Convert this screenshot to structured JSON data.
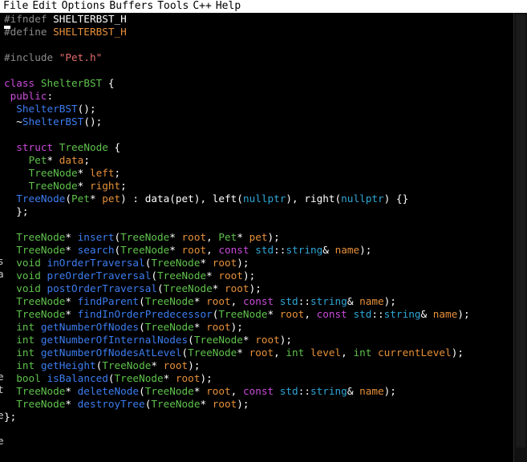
{
  "menu": [
    "File",
    "Edit",
    "Options",
    "Buffers",
    "Tools",
    "C++",
    "Help"
  ],
  "colors": {
    "background": "#000000",
    "preprocessor": "#8a8a8a",
    "macro": "#e6903a",
    "string": "#e46c6c",
    "keyword": "#c94bd9",
    "type": "#5fc24c",
    "function": "#3c7df0",
    "builtin": "#2fa6d6",
    "plain": "#ffffff"
  },
  "lines": [
    [
      [
        "#ifndef ",
        "pp"
      ],
      [
        "SHELTERBST_H",
        "macro-w"
      ]
    ],
    [
      [
        "#define ",
        "pp"
      ],
      [
        "SHELTERBST_H",
        "macro"
      ]
    ],
    [],
    [
      [
        "#include ",
        "pp"
      ],
      [
        "\"Pet.h\"",
        "str"
      ]
    ],
    [],
    [
      [
        "class ",
        "kw"
      ],
      [
        "ShelterBST",
        "type"
      ],
      [
        " {",
        "plain"
      ]
    ],
    [
      [
        " public",
        "kw"
      ],
      [
        ":",
        "plain"
      ]
    ],
    [
      [
        "  ",
        "plain"
      ],
      [
        "ShelterBST",
        "fn"
      ],
      [
        "();",
        "plain"
      ]
    ],
    [
      [
        "  ~",
        "plain"
      ],
      [
        "ShelterBST",
        "fn"
      ],
      [
        "();",
        "plain"
      ]
    ],
    [],
    [
      [
        "  ",
        "plain"
      ],
      [
        "struct ",
        "kw"
      ],
      [
        "TreeNode",
        "type"
      ],
      [
        " {",
        "plain"
      ]
    ],
    [
      [
        "    ",
        "plain"
      ],
      [
        "Pet",
        "type"
      ],
      [
        "* ",
        "plain"
      ],
      [
        "data",
        "var"
      ],
      [
        ";",
        "plain"
      ]
    ],
    [
      [
        "    ",
        "plain"
      ],
      [
        "TreeNode",
        "type"
      ],
      [
        "* ",
        "plain"
      ],
      [
        "left",
        "var"
      ],
      [
        ";",
        "plain"
      ]
    ],
    [
      [
        "    ",
        "plain"
      ],
      [
        "TreeNode",
        "type"
      ],
      [
        "* ",
        "plain"
      ],
      [
        "right",
        "var"
      ],
      [
        ";",
        "plain"
      ]
    ],
    [
      [
        "  ",
        "plain"
      ],
      [
        "TreeNode",
        "fn"
      ],
      [
        "(",
        "plain"
      ],
      [
        "Pet",
        "type"
      ],
      [
        "* ",
        "plain"
      ],
      [
        "pet",
        "var"
      ],
      [
        ") : data(pet), left(",
        "plain"
      ],
      [
        "nullptr",
        "builtin"
      ],
      [
        "), right(",
        "plain"
      ],
      [
        "nullptr",
        "builtin"
      ],
      [
        ") {}",
        "plain"
      ]
    ],
    [
      [
        "  };",
        "plain"
      ]
    ],
    [],
    [
      [
        "  ",
        "plain"
      ],
      [
        "TreeNode",
        "type"
      ],
      [
        "* ",
        "plain"
      ],
      [
        "insert",
        "fn"
      ],
      [
        "(",
        "plain"
      ],
      [
        "TreeNode",
        "type"
      ],
      [
        "* ",
        "plain"
      ],
      [
        "root",
        "var"
      ],
      [
        ", ",
        "plain"
      ],
      [
        "Pet",
        "type"
      ],
      [
        "* ",
        "plain"
      ],
      [
        "pet",
        "var"
      ],
      [
        ");",
        "plain"
      ]
    ],
    [
      [
        "  ",
        "plain"
      ],
      [
        "TreeNode",
        "type"
      ],
      [
        "* ",
        "plain"
      ],
      [
        "search",
        "fn"
      ],
      [
        "(",
        "plain"
      ],
      [
        "TreeNode",
        "type"
      ],
      [
        "* ",
        "plain"
      ],
      [
        "root",
        "var"
      ],
      [
        ", ",
        "plain"
      ],
      [
        "const ",
        "kw"
      ],
      [
        "std",
        "builtin"
      ],
      [
        "::",
        "plain"
      ],
      [
        "string",
        "builtin"
      ],
      [
        "& ",
        "plain"
      ],
      [
        "name",
        "var"
      ],
      [
        ");",
        "plain"
      ]
    ],
    [
      [
        "  ",
        "plain"
      ],
      [
        "void ",
        "type"
      ],
      [
        "inOrderTraversal",
        "fn"
      ],
      [
        "(",
        "plain"
      ],
      [
        "TreeNode",
        "type"
      ],
      [
        "* ",
        "plain"
      ],
      [
        "root",
        "var"
      ],
      [
        ");",
        "plain"
      ]
    ],
    [
      [
        "  ",
        "plain"
      ],
      [
        "void ",
        "type"
      ],
      [
        "preOrderTraversal",
        "fn"
      ],
      [
        "(",
        "plain"
      ],
      [
        "TreeNode",
        "type"
      ],
      [
        "* ",
        "plain"
      ],
      [
        "root",
        "var"
      ],
      [
        ");",
        "plain"
      ]
    ],
    [
      [
        "  ",
        "plain"
      ],
      [
        "void ",
        "type"
      ],
      [
        "postOrderTraversal",
        "fn"
      ],
      [
        "(",
        "plain"
      ],
      [
        "TreeNode",
        "type"
      ],
      [
        "* ",
        "plain"
      ],
      [
        "root",
        "var"
      ],
      [
        ");",
        "plain"
      ]
    ],
    [
      [
        "  ",
        "plain"
      ],
      [
        "TreeNode",
        "type"
      ],
      [
        "* ",
        "plain"
      ],
      [
        "findParent",
        "fn"
      ],
      [
        "(",
        "plain"
      ],
      [
        "TreeNode",
        "type"
      ],
      [
        "* ",
        "plain"
      ],
      [
        "root",
        "var"
      ],
      [
        ", ",
        "plain"
      ],
      [
        "const ",
        "kw"
      ],
      [
        "std",
        "builtin"
      ],
      [
        "::",
        "plain"
      ],
      [
        "string",
        "builtin"
      ],
      [
        "& ",
        "plain"
      ],
      [
        "name",
        "var"
      ],
      [
        ");",
        "plain"
      ]
    ],
    [
      [
        "  ",
        "plain"
      ],
      [
        "TreeNode",
        "type"
      ],
      [
        "* ",
        "plain"
      ],
      [
        "findInOrderPredecessor",
        "fn"
      ],
      [
        "(",
        "plain"
      ],
      [
        "TreeNode",
        "type"
      ],
      [
        "* ",
        "plain"
      ],
      [
        "root",
        "var"
      ],
      [
        ", ",
        "plain"
      ],
      [
        "const ",
        "kw"
      ],
      [
        "std",
        "builtin"
      ],
      [
        "::",
        "plain"
      ],
      [
        "string",
        "builtin"
      ],
      [
        "& ",
        "plain"
      ],
      [
        "name",
        "var"
      ],
      [
        ");",
        "plain"
      ]
    ],
    [
      [
        "  ",
        "plain"
      ],
      [
        "int ",
        "type"
      ],
      [
        "getNumberOfNodes",
        "fn"
      ],
      [
        "(",
        "plain"
      ],
      [
        "TreeNode",
        "type"
      ],
      [
        "* ",
        "plain"
      ],
      [
        "root",
        "var"
      ],
      [
        ");",
        "plain"
      ]
    ],
    [
      [
        "  ",
        "plain"
      ],
      [
        "int ",
        "type"
      ],
      [
        "getNumberOfInternalNodes",
        "fn"
      ],
      [
        "(",
        "plain"
      ],
      [
        "TreeNode",
        "type"
      ],
      [
        "* ",
        "plain"
      ],
      [
        "root",
        "var"
      ],
      [
        ");",
        "plain"
      ]
    ],
    [
      [
        "  ",
        "plain"
      ],
      [
        "int ",
        "type"
      ],
      [
        "getNumberOfNodesAtLevel",
        "fn"
      ],
      [
        "(",
        "plain"
      ],
      [
        "TreeNode",
        "type"
      ],
      [
        "* ",
        "plain"
      ],
      [
        "root",
        "var"
      ],
      [
        ", ",
        "plain"
      ],
      [
        "int ",
        "type"
      ],
      [
        "level",
        "var"
      ],
      [
        ", ",
        "plain"
      ],
      [
        "int ",
        "type"
      ],
      [
        "currentLevel",
        "var"
      ],
      [
        ");",
        "plain"
      ]
    ],
    [
      [
        "  ",
        "plain"
      ],
      [
        "int ",
        "type"
      ],
      [
        "getHeight",
        "fn"
      ],
      [
        "(",
        "plain"
      ],
      [
        "TreeNode",
        "type"
      ],
      [
        "* ",
        "plain"
      ],
      [
        "root",
        "var"
      ],
      [
        ");",
        "plain"
      ]
    ],
    [
      [
        "  ",
        "plain"
      ],
      [
        "bool ",
        "type"
      ],
      [
        "isBalanced",
        "fn"
      ],
      [
        "(",
        "plain"
      ],
      [
        "TreeNode",
        "type"
      ],
      [
        "* ",
        "plain"
      ],
      [
        "root",
        "var"
      ],
      [
        ");",
        "plain"
      ]
    ],
    [
      [
        "  ",
        "plain"
      ],
      [
        "TreeNode",
        "type"
      ],
      [
        "* ",
        "plain"
      ],
      [
        "deleteNode",
        "fn"
      ],
      [
        "(",
        "plain"
      ],
      [
        "TreeNode",
        "type"
      ],
      [
        "* ",
        "plain"
      ],
      [
        "root",
        "var"
      ],
      [
        ", ",
        "plain"
      ],
      [
        "const ",
        "kw"
      ],
      [
        "std",
        "builtin"
      ],
      [
        "::",
        "plain"
      ],
      [
        "string",
        "builtin"
      ],
      [
        "& ",
        "plain"
      ],
      [
        "name",
        "var"
      ],
      [
        ");",
        "plain"
      ]
    ],
    [
      [
        "  ",
        "plain"
      ],
      [
        "TreeNode",
        "type"
      ],
      [
        "* ",
        "plain"
      ],
      [
        "destroyTree",
        "fn"
      ],
      [
        "(",
        "plain"
      ],
      [
        "TreeNode",
        "type"
      ],
      [
        "* ",
        "plain"
      ],
      [
        "root",
        "var"
      ],
      [
        ");",
        "plain"
      ]
    ],
    [
      [
        "};",
        "plain"
      ]
    ]
  ],
  "left_edge": [
    {
      "line": 19,
      "text": "s"
    },
    {
      "line": 20,
      "text": "a"
    },
    {
      "line": 28,
      "text": "e"
    },
    {
      "line": 29,
      "text": "t"
    },
    {
      "line": 31,
      "text": "e"
    },
    {
      "line": 33,
      "text": "e"
    }
  ]
}
